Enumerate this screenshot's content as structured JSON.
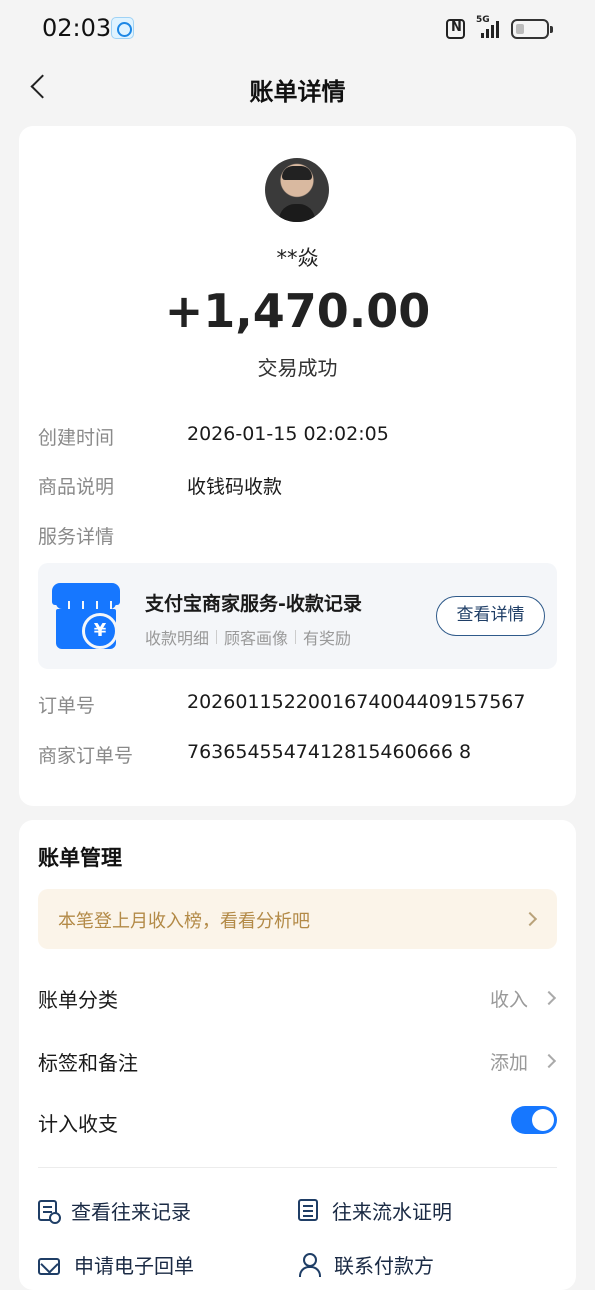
{
  "status_bar": {
    "time": "02:03",
    "network": "5G",
    "icons": [
      "app-notification-icon",
      "nfc-icon",
      "signal-icon",
      "battery-icon"
    ]
  },
  "nav": {
    "title": "账单详情",
    "back_icon": "chevron-left-icon"
  },
  "transaction": {
    "payer_name": "**焱",
    "amount": "+1,470.00",
    "status": "交易成功",
    "fields": {
      "created_label": "创建时间",
      "created_value": "2026-01-15 02:02:05",
      "product_label": "商品说明",
      "product_value": "收钱码收款",
      "service_label": "服务详情",
      "order_label": "订单号",
      "order_value": "2026011522001674004409157567",
      "merchant_order_label": "商家订单号",
      "merchant_order_value": "7636545547412815460666 8"
    },
    "service": {
      "title": "支付宝商家服务-收款记录",
      "tags": [
        "收款明细",
        "顾客画像",
        "有奖励"
      ],
      "button_label": "查看详情",
      "icon": "merchant-store-icon"
    }
  },
  "manage": {
    "title": "账单管理",
    "insight_text": "本笔登上月收入榜，看看分析吧",
    "category_label": "账单分类",
    "category_value": "收入",
    "tags_label": "标签和备注",
    "tags_value": "添加",
    "count_label": "计入收支",
    "count_enabled": true,
    "actions": [
      {
        "label": "查看往来记录",
        "icon": "records-search-icon"
      },
      {
        "label": "往来流水证明",
        "icon": "document-proof-icon"
      },
      {
        "label": "申请电子回单",
        "icon": "mail-icon"
      },
      {
        "label": "联系付款方",
        "icon": "contact-person-icon"
      }
    ]
  },
  "colors": {
    "accent": "#1677ff",
    "insight_bg": "#fbf4e9",
    "insight_text": "#b38a47",
    "page_bg": "#f4f4f4"
  }
}
